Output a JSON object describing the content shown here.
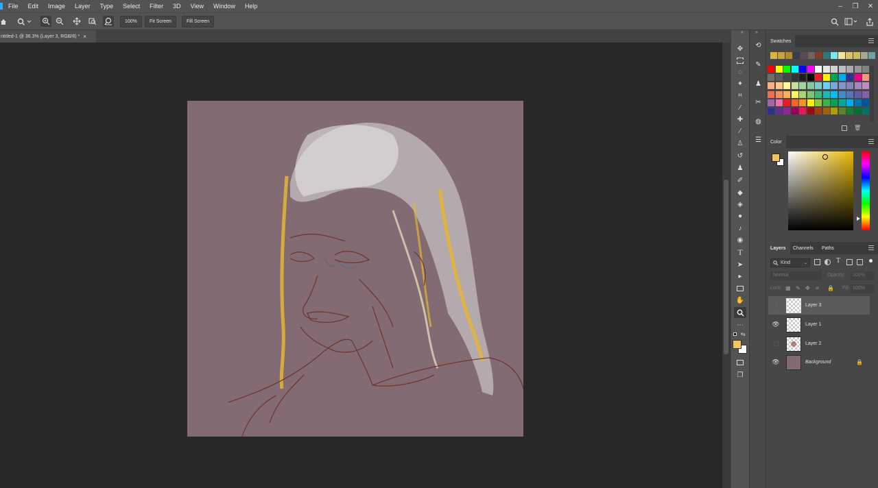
{
  "app": {
    "icon": "photoshop-logo-icon"
  },
  "menu": [
    "File",
    "Edit",
    "Image",
    "Layer",
    "Type",
    "Select",
    "Filter",
    "3D",
    "View",
    "Window",
    "Help"
  ],
  "options": {
    "zoom_value": "100%",
    "fit_screen": "Fit Screen",
    "fill_screen": "Fill Screen"
  },
  "document": {
    "tab_title": "ntitled-1 @ 36.3% (Layer 3, RGB/8) *",
    "close": "×"
  },
  "panels": {
    "swatches": {
      "title": "Swatches"
    },
    "color": {
      "title": "Color",
      "foreground": "#f1c75d",
      "background": "#ffffff"
    },
    "layers": {
      "tabs": [
        "Layers",
        "Channels",
        "Paths"
      ],
      "filter_kind": "Kind",
      "blend_mode": "Normal",
      "opacity_label": "Opacity:",
      "opacity_value": "100%",
      "lock_label": "Lock:",
      "fill_label": "Fill:",
      "fill_value": "100%",
      "items": [
        {
          "name": "Layer 3",
          "visible": false,
          "selected": true
        },
        {
          "name": "Layer 1",
          "visible": true,
          "selected": false
        },
        {
          "name": "Layer 2",
          "visible": false,
          "selected": false
        },
        {
          "name": "Background",
          "visible": true,
          "selected": false,
          "locked": true,
          "color": "#836b73"
        }
      ]
    }
  },
  "colors": {
    "canvas": "#836b73",
    "sketch_line": "#6b2e22",
    "hair_white": "#dcdcdc",
    "hair_yellow": "#e6b630"
  }
}
